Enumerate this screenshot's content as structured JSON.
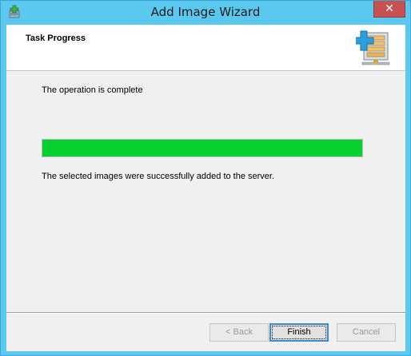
{
  "window": {
    "title": "Add Image Wizard",
    "close_glyph": "✕",
    "icon": "wizard-app-icon",
    "titlebar_color": "#5bc8ef"
  },
  "header": {
    "title": "Task Progress",
    "icon": "add-image-server-icon"
  },
  "main": {
    "status": "The operation is complete",
    "progress_percent": 100,
    "progress_color": "#06d02e",
    "result": "The selected images were successfully added to the server."
  },
  "buttons": {
    "back": {
      "label": "< Back",
      "enabled": false
    },
    "finish": {
      "label": "Finish",
      "enabled": true,
      "default": true
    },
    "cancel": {
      "label": "Cancel",
      "enabled": false
    }
  }
}
